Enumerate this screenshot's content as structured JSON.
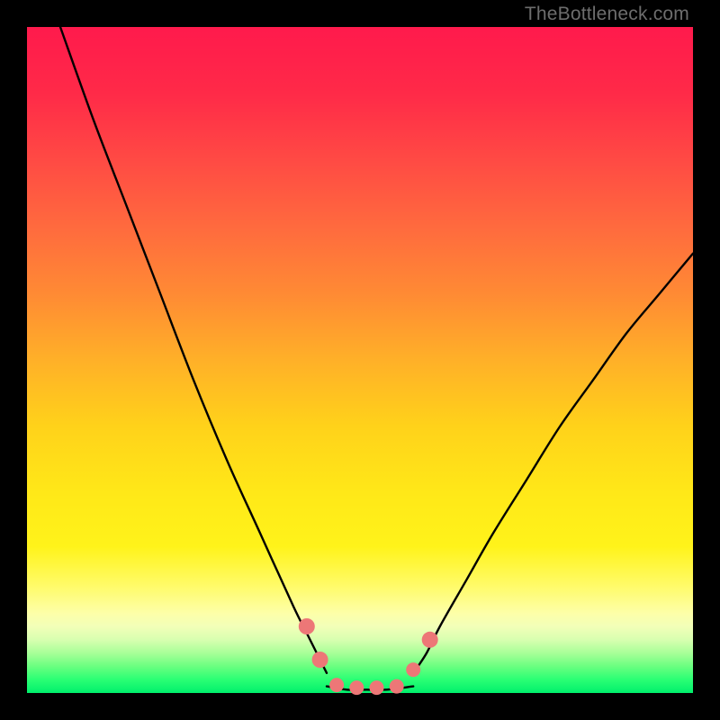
{
  "watermark": "TheBottleneck.com",
  "chart_data": {
    "type": "line",
    "xlim": [
      0,
      100
    ],
    "ylim": [
      0,
      100
    ],
    "xlabel": "",
    "ylabel": "",
    "title": "",
    "grid": false,
    "legend": false,
    "series": [
      {
        "name": "left-curve",
        "color": "#000000",
        "x": [
          5,
          10,
          15,
          20,
          25,
          30,
          35,
          40,
          42,
          44,
          45
        ],
        "y": [
          100,
          86,
          73,
          60,
          47,
          35,
          24,
          13,
          9,
          5,
          3
        ]
      },
      {
        "name": "right-curve",
        "color": "#000000",
        "x": [
          58,
          60,
          62,
          66,
          70,
          75,
          80,
          85,
          90,
          95,
          100
        ],
        "y": [
          3,
          6,
          10,
          17,
          24,
          32,
          40,
          47,
          54,
          60,
          66
        ]
      },
      {
        "name": "valley-floor",
        "color": "#000000",
        "x": [
          45,
          48,
          51,
          54,
          58
        ],
        "y": [
          1,
          0.5,
          0.5,
          0.5,
          1
        ]
      }
    ],
    "markers": [
      {
        "name": "marker-left-upper",
        "x": 42.0,
        "y": 10,
        "r": 9,
        "color": "#ed7777"
      },
      {
        "name": "marker-left-lower",
        "x": 44.0,
        "y": 5,
        "r": 9,
        "color": "#ed7777"
      },
      {
        "name": "marker-floor-1",
        "x": 46.5,
        "y": 1.2,
        "r": 8,
        "color": "#ed7777"
      },
      {
        "name": "marker-floor-2",
        "x": 49.5,
        "y": 0.8,
        "r": 8,
        "color": "#ed7777"
      },
      {
        "name": "marker-floor-3",
        "x": 52.5,
        "y": 0.8,
        "r": 8,
        "color": "#ed7777"
      },
      {
        "name": "marker-floor-4",
        "x": 55.5,
        "y": 1.0,
        "r": 8,
        "color": "#ed7777"
      },
      {
        "name": "marker-right-lower",
        "x": 58.0,
        "y": 3.5,
        "r": 8,
        "color": "#ed7777"
      },
      {
        "name": "marker-right-upper",
        "x": 60.5,
        "y": 8,
        "r": 9,
        "color": "#ed7777"
      }
    ],
    "gradient_bands": [
      {
        "y": 84,
        "color": "#fdffa8"
      },
      {
        "y": 88,
        "color": "#f2ffb8"
      },
      {
        "y": 90,
        "color": "#d8ffb0"
      },
      {
        "y": 92,
        "color": "#a8ff98"
      },
      {
        "y": 94,
        "color": "#6aff80"
      },
      {
        "y": 96,
        "color": "#2aff74"
      },
      {
        "y": 98,
        "color": "#00ef6c"
      }
    ]
  }
}
